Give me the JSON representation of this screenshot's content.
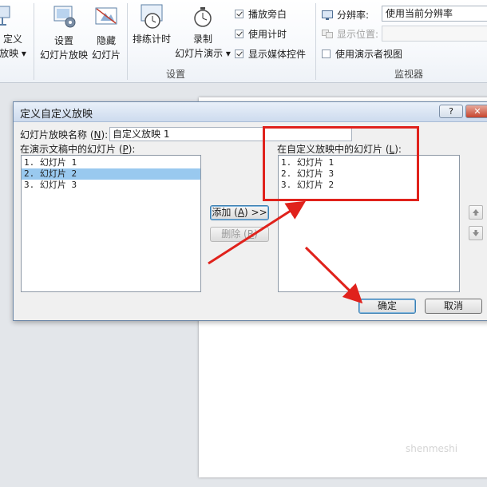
{
  "ribbon": {
    "cut_left": {
      "line1": "定义",
      "line2": "放映 ▾"
    },
    "setup_show": {
      "line1": "设置",
      "line2": "幻灯片放映"
    },
    "hide_slide": {
      "line1": "隐藏",
      "line2": "幻灯片"
    },
    "rehearse": {
      "label": "排练计时"
    },
    "record": {
      "line1": "录制",
      "line2": "幻灯片演示 ▾"
    },
    "options": {
      "narration": "播放旁白",
      "timings": "使用计时",
      "media_controls": "显示媒体控件"
    },
    "group_setup": "设置",
    "monitor": {
      "resolution_label": "分辨率:",
      "resolution_value": "使用当前分辨率",
      "show_on_label": "显示位置:",
      "presenter_view": "使用演示者视图",
      "group_label": "监视器"
    }
  },
  "dialog": {
    "title": "定义自定义放映",
    "help": "?",
    "close": "✕",
    "name_label_pre": "幻灯片放映名称 (",
    "name_label_key": "N",
    "name_label_post": "):",
    "name_value": "自定义放映 1",
    "left_label_pre": "在演示文稿中的幻灯片 (",
    "left_label_key": "P",
    "left_label_post": "):",
    "left_items": [
      "1. 幻灯片 1",
      "2. 幻灯片 2",
      "3. 幻灯片 3"
    ],
    "right_label_pre": "在自定义放映中的幻灯片 (",
    "right_label_key": "L",
    "right_label_post": "):",
    "right_items": [
      "1. 幻灯片 1",
      "2. 幻灯片 3",
      "3. 幻灯片 2"
    ],
    "add_pre": "添加 (",
    "add_key": "A",
    "add_post": ") >>",
    "remove_pre": "删除 (",
    "remove_key": "R",
    "remove_post": ")",
    "ok": "确定",
    "cancel": "取消"
  },
  "watermark": "shenmeshi",
  "colors": {
    "annotation_red": "#e0221c",
    "selection": "#99c9ef"
  }
}
